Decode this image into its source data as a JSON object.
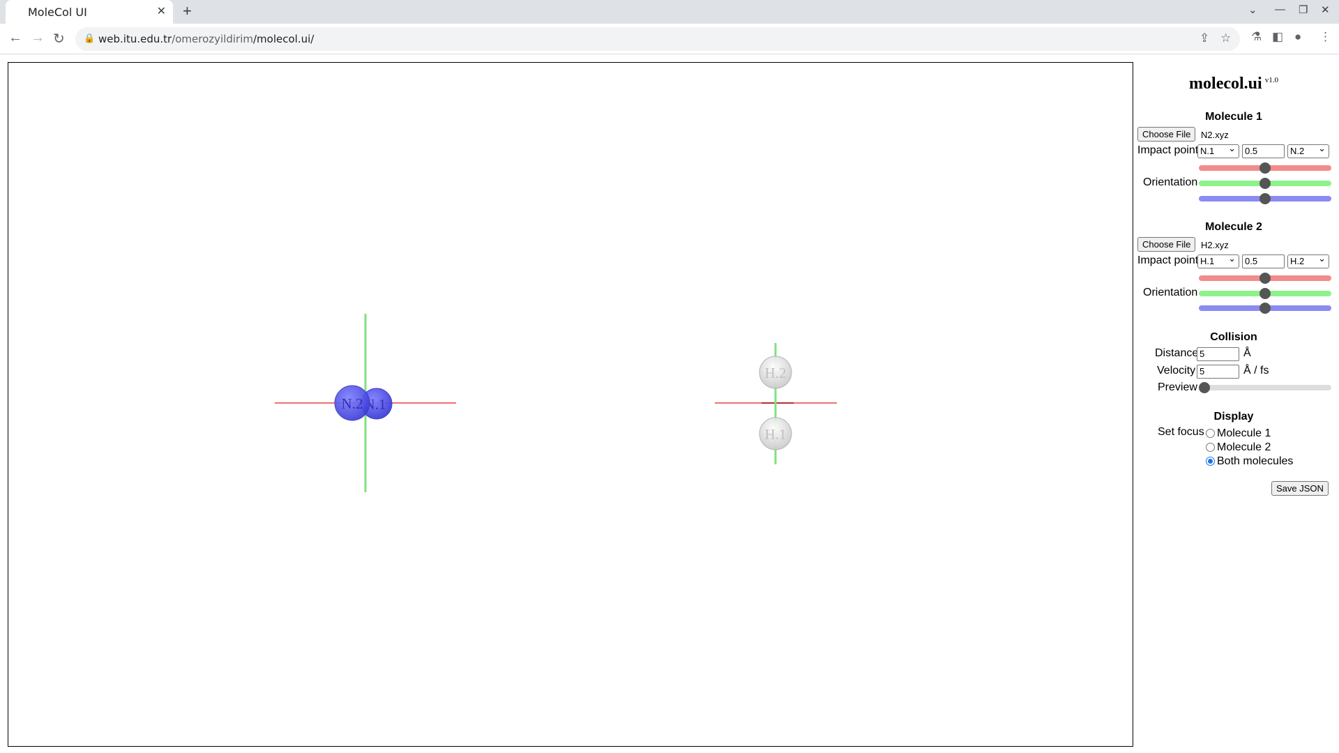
{
  "browser": {
    "tab_title": "MoleCol UI",
    "url_host": "web.itu.edu.tr",
    "url_path": "/omerozyildirim",
    "url_tail": "/molecol.ui/"
  },
  "app": {
    "title": "molecol.ui",
    "version": "v1.0"
  },
  "molecule1": {
    "heading": "Molecule 1",
    "file_button": "Choose File",
    "file_name": "N2.xyz",
    "impact_label": "Impact point",
    "impact_from": "N.1",
    "impact_value": "0.5",
    "impact_to": "N.2",
    "orientation_label": "Orientation",
    "sliders": [
      {
        "color": "#f28b8b",
        "value": 0.5
      },
      {
        "color": "#8ef28b",
        "value": 0.5
      },
      {
        "color": "#8b8bf2",
        "value": 0.5
      }
    ]
  },
  "molecule2": {
    "heading": "Molecule 2",
    "file_button": "Choose File",
    "file_name": "H2.xyz",
    "impact_label": "Impact point",
    "impact_from": "H.1",
    "impact_value": "0.5",
    "impact_to": "H.2",
    "orientation_label": "Orientation",
    "sliders": [
      {
        "color": "#f28b8b",
        "value": 0.5
      },
      {
        "color": "#8ef28b",
        "value": 0.5
      },
      {
        "color": "#8b8bf2",
        "value": 0.5
      }
    ]
  },
  "collision": {
    "heading": "Collision",
    "distance_label": "Distance",
    "distance_value": "5",
    "distance_unit": "Å",
    "velocity_label": "Velocity",
    "velocity_value": "5",
    "velocity_unit": "Å / fs",
    "preview_label": "Preview",
    "preview_value": 0
  },
  "display": {
    "heading": "Display",
    "focus_label": "Set focus",
    "options": [
      "Molecule 1",
      "Molecule 2",
      "Both molecules"
    ],
    "selected_index": 2
  },
  "save_button": "Save JSON",
  "scene": {
    "atoms": [
      {
        "label": "N.2",
        "color": "#5a5aee"
      },
      {
        "label": "N.1",
        "color": "#5a5aee"
      },
      {
        "label": "H.2",
        "color": "#e8e8e8"
      },
      {
        "label": "H.1",
        "color": "#e8e8e8"
      }
    ],
    "axis_colors": {
      "x": "#f07070",
      "y": "#80e080"
    }
  }
}
